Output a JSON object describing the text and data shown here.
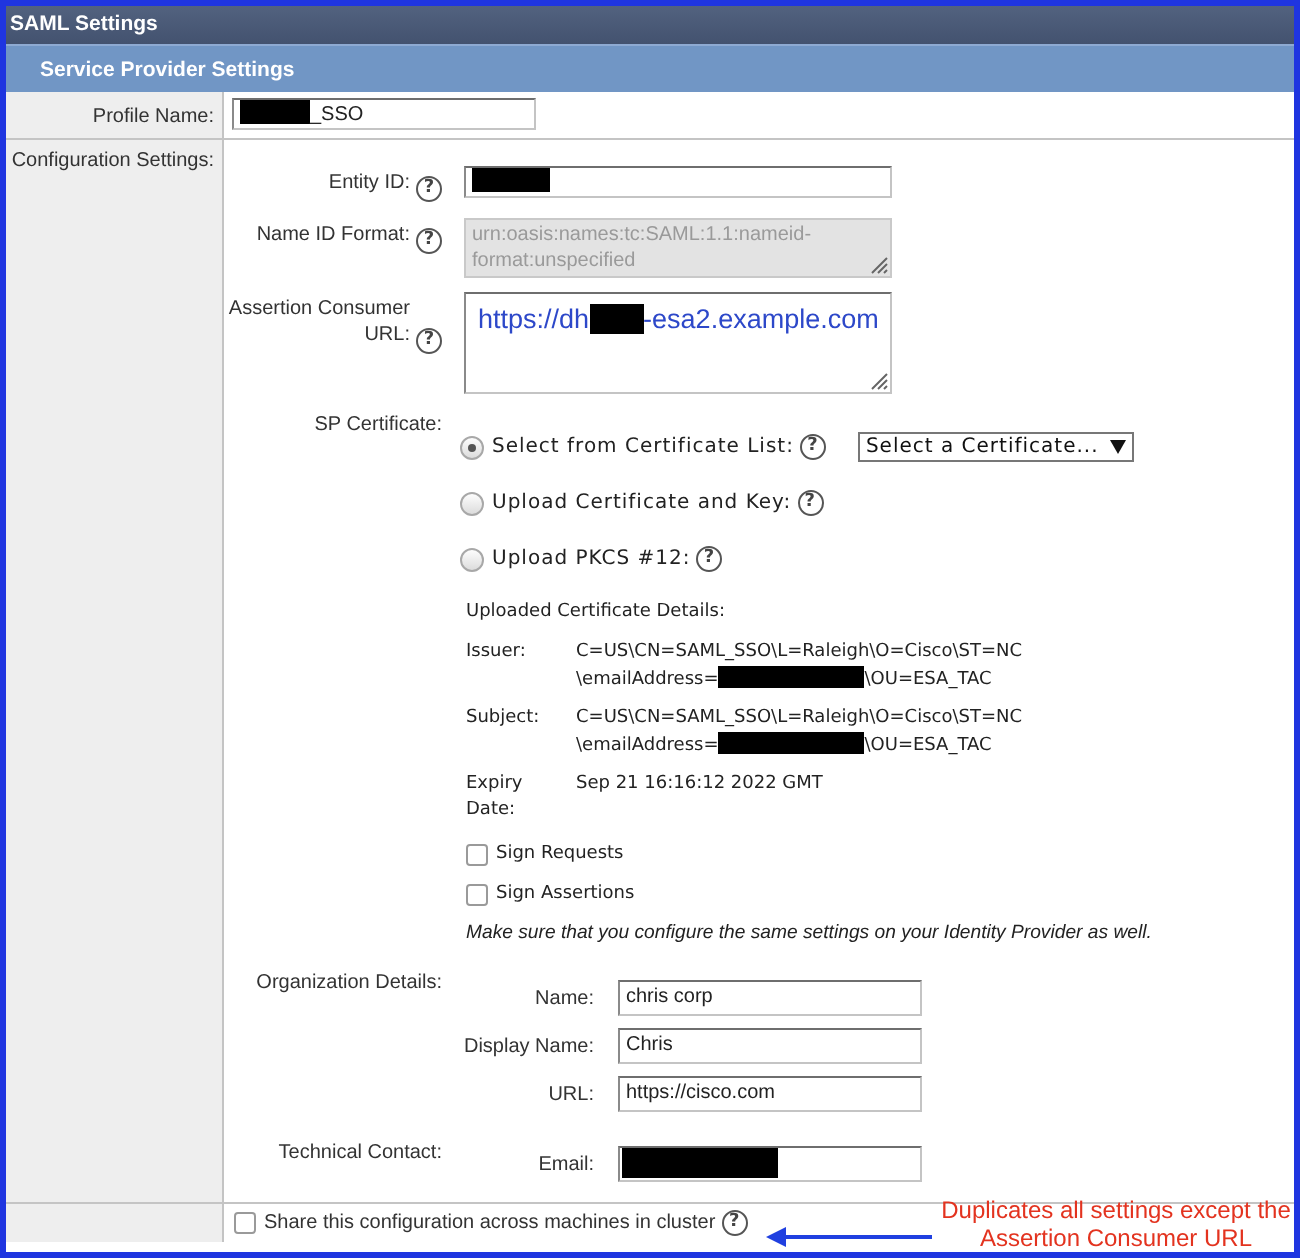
{
  "window": {
    "title": "SAML Settings"
  },
  "section": {
    "title": "Service Provider Settings"
  },
  "profile": {
    "label": "Profile Name:",
    "value": [
      {
        "kind": "redaction"
      },
      {
        "kind": "text",
        "text": "_SSO"
      }
    ]
  },
  "config": {
    "label": "Configuration Settings:",
    "fields": [
      {
        "kind": "input",
        "label": "Entity ID:",
        "help": "?",
        "disabled": false,
        "value": [
          {
            "kind": "redaction"
          }
        ]
      },
      {
        "kind": "textarea",
        "label": "Name ID Format:",
        "help": "?",
        "disabled": true,
        "value": [
          {
            "kind": "text",
            "text": "urn:oasis:names:tc:SAML:1.1:nameid-format:unspecified"
          }
        ]
      },
      {
        "kind": "url",
        "label": "Assertion Consumer URL:",
        "help": "?",
        "disabled": false,
        "value": [
          {
            "kind": "text",
            "text": "https://dh"
          },
          {
            "kind": "redaction"
          },
          {
            "kind": "text",
            "text": "-esa2.example.com"
          }
        ]
      }
    ],
    "certificate": {
      "label": "SP Certificate:",
      "options": [
        {
          "label": "Select from Certificate List:",
          "help": "?",
          "selected": true,
          "select": "Select a Certificate..."
        },
        {
          "label": "Upload Certificate and Key:",
          "help": "?",
          "selected": false
        },
        {
          "label": "Upload PKCS #12:",
          "help": "?",
          "selected": false
        }
      ],
      "details": {
        "title": "Uploaded Certificate Details:",
        "rows": [
          {
            "label": "Issuer:",
            "lines": [
              [
                {
                  "kind": "text",
                  "text": "C=US\\CN=SAML_SSO\\L=Raleigh\\O=Cisco\\ST=NC"
                }
              ],
              [
                {
                  "kind": "text",
                  "text": "\\emailAddress="
                },
                {
                  "kind": "redaction"
                },
                {
                  "kind": "text",
                  "text": "\\OU=ESA_TAC"
                }
              ]
            ]
          },
          {
            "label": "Subject:",
            "lines": [
              [
                {
                  "kind": "text",
                  "text": "C=US\\CN=SAML_SSO\\L=Raleigh\\O=Cisco\\ST=NC"
                }
              ],
              [
                {
                  "kind": "text",
                  "text": "\\emailAddress="
                },
                {
                  "kind": "redaction"
                },
                {
                  "kind": "text",
                  "text": "\\OU=ESA_TAC"
                }
              ]
            ]
          },
          {
            "label": "Expiry Date:",
            "lines": [
              [
                {
                  "kind": "text",
                  "text": "Sep 21 16:16:12 2022 GMT"
                }
              ]
            ]
          }
        ]
      },
      "checkboxes": [
        {
          "label": "Sign Requests",
          "checked": false
        },
        {
          "label": "Sign Assertions",
          "checked": false
        }
      ],
      "note": "Make sure that you configure the same settings on your Identity Provider as well."
    },
    "organization": {
      "label": "Organization Details:",
      "fields": [
        {
          "label": "Name:",
          "value": [
            {
              "kind": "text",
              "text": "chris corp"
            }
          ]
        },
        {
          "label": "Display Name:",
          "value": [
            {
              "kind": "text",
              "text": "Chris"
            }
          ]
        },
        {
          "label": "URL:",
          "value": [
            {
              "kind": "text",
              "text": "https://cisco.com"
            }
          ]
        }
      ]
    },
    "technical_contact": {
      "label": "Technical Contact:",
      "fields": [
        {
          "label": "Email:",
          "value": [
            {
              "kind": "redaction"
            }
          ]
        }
      ]
    }
  },
  "cluster": {
    "label": "Share this configuration across machines in cluster",
    "checked": false,
    "help": "?"
  },
  "annotation": {
    "text": "Duplicates all settings except the Assertion Consumer URL"
  }
}
